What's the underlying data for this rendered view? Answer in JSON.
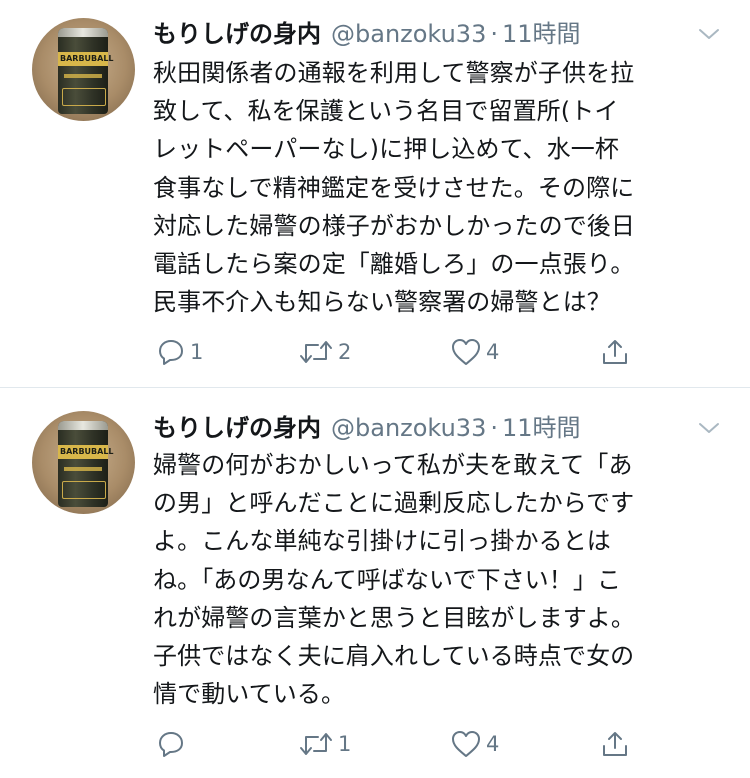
{
  "tweets": [
    {
      "name": "もりしげの身内",
      "handle": "@banzoku33",
      "separator": "·",
      "time": "11時間",
      "avatar_can_label": "BARBUBALL",
      "text": "秋田関係者の通報を利用して警察が子供を拉\n致して、私を保護という名目で留置所(トイ\nレットペーパーなし)に押し込めて、水一杯\n食事なしで精神鑑定を受けさせた。その際に\n対応した婦警の様子がおかしかったので後日\n電話したら案の定「離婚しろ」の一点張り。\n民事不介入も知らない警察署の婦警とは？",
      "reply_count": "1",
      "retweet_count": "2",
      "like_count": "4",
      "icons": [
        "reply-icon",
        "retweet-icon",
        "like-icon",
        "share-icon",
        "chevron-down-icon"
      ]
    },
    {
      "name": "もりしげの身内",
      "handle": "@banzoku33",
      "separator": "·",
      "time": "11時間",
      "avatar_can_label": "BARBUBALL",
      "text": "婦警の何がおかしいって私が夫を敢えて「あ\nの男」と呼んだことに過剰反応したからです\nよ。こんな単純な引掛けに引っ掛かるとは\nね。「あの男なんて呼ばないで下さい！」こ\nれが婦警の言葉かと思うと目眩がしますよ。\n子供ではなく夫に肩入れしている時点で女の\n情で動いている。",
      "reply_count": "",
      "retweet_count": "1",
      "like_count": "4",
      "icons": [
        "reply-icon",
        "retweet-icon",
        "like-icon",
        "share-icon",
        "chevron-down-icon"
      ]
    }
  ],
  "colors": {
    "text": "#14171a",
    "secondary": "#657786",
    "divider": "#e1e8ed",
    "background": "#ffffff"
  }
}
